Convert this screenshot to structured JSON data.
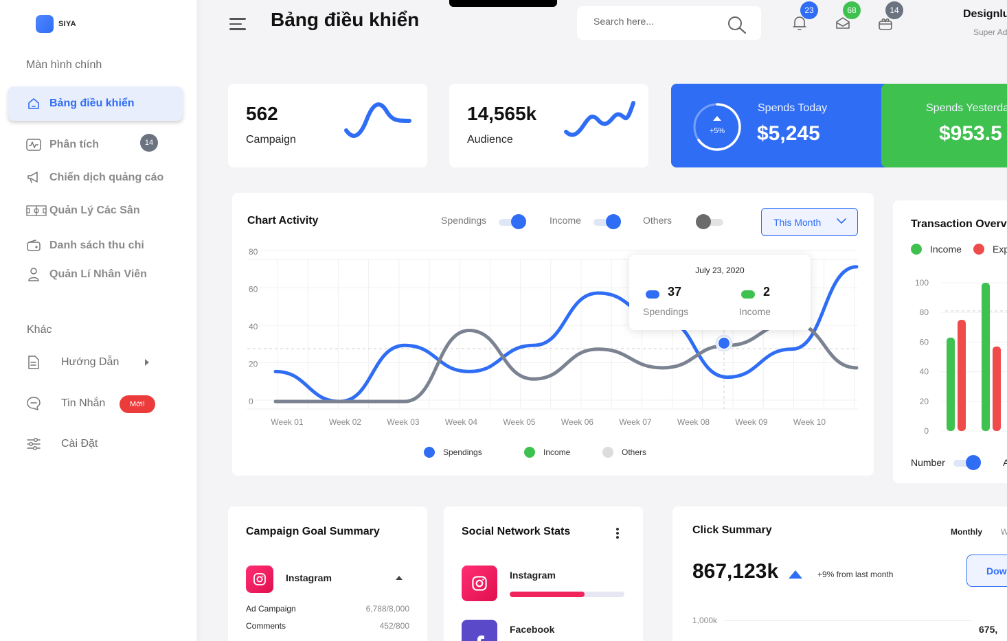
{
  "brand": {
    "name": "SIYA",
    "color": "#2f6df5"
  },
  "sidebar": {
    "main_section": "Màn hình chính",
    "items": [
      {
        "label": "Bảng điều khiển",
        "icon": "home-icon",
        "active": true
      },
      {
        "label": "Phân tích",
        "icon": "analytics-icon",
        "count": "14"
      },
      {
        "label": "Chiến dịch quảng cáo",
        "icon": "megaphone-icon"
      },
      {
        "label": "Quản Lý Các Sân",
        "icon": "field-icon"
      },
      {
        "label": "Danh sách thu chi",
        "icon": "wallet-icon"
      },
      {
        "label": "Quản Lí Nhân Viên",
        "icon": "user-icon"
      }
    ],
    "other_section": "Khác",
    "other_items": [
      {
        "label": "Hướng Dẫn",
        "icon": "document-icon"
      },
      {
        "label": "Tin Nhắn",
        "icon": "chat-icon",
        "badge": "Mới!"
      },
      {
        "label": "Cài Đặt",
        "icon": "settings-sliders-icon"
      }
    ]
  },
  "header": {
    "title": "Bảng điều khiển",
    "search_placeholder": "Search here...",
    "notifications": {
      "bell": "23",
      "mail": "68",
      "cart": "14"
    },
    "user_name": "Designlu",
    "user_role": "Super Ad"
  },
  "stats": {
    "campaign": {
      "value": "562",
      "label": "Campaign"
    },
    "audience": {
      "value": "14,565k",
      "label": "Audience"
    },
    "spends_today": {
      "label": "Spends Today",
      "value": "$5,245",
      "change": "+5%"
    },
    "spends_yesterday": {
      "label": "Spends Yesterda",
      "value": "$953.5"
    }
  },
  "chart_activity": {
    "title": "Chart Activity",
    "toggles": {
      "spendings": "Spendings",
      "income": "Income",
      "others": "Others"
    },
    "period_button": "This Month",
    "tooltip": {
      "date": "July 23, 2020",
      "spendings_value": "37",
      "spendings_label": "Spendings",
      "income_value": "2",
      "income_label": "Income"
    },
    "legend": {
      "spendings": "Spendings",
      "income": "Income",
      "others": "Others"
    }
  },
  "chart_data": [
    {
      "type": "line",
      "title": "Chart Activity",
      "categories": [
        "Week 01",
        "Week 02",
        "Week 03",
        "Week 04",
        "Week 05",
        "Week 06",
        "Week 07",
        "Week 08",
        "Week 09",
        "Week 10"
      ],
      "y_ticks": [
        "0",
        "20",
        "40",
        "60",
        "80"
      ],
      "ylim": [
        0,
        90
      ],
      "series": [
        {
          "name": "Spendings",
          "color": "#2f6df5",
          "values": [
            16,
            0,
            30,
            16,
            30,
            58,
            44,
            13,
            28,
            72
          ]
        },
        {
          "name": "Others",
          "color": "#7b8291",
          "values": [
            0,
            0,
            0,
            38,
            12,
            28,
            18,
            30,
            42,
            18
          ]
        }
      ],
      "grid": true
    },
    {
      "type": "bar",
      "title": "Transaction Overvi",
      "y_ticks": [
        "0",
        "20",
        "40",
        "60",
        "80",
        "100"
      ],
      "ylim": [
        0,
        100
      ],
      "series": [
        {
          "name": "Income",
          "color": "#3fc14f",
          "values": [
            63,
            100
          ]
        },
        {
          "name": "Exp",
          "color": "#ef4b4b",
          "values": [
            75,
            57
          ]
        }
      ],
      "toggle_label": "Number"
    }
  ],
  "transaction": {
    "title": "Transaction Overvi",
    "legend_income": "Income",
    "legend_exp": "Exp",
    "toggle_label": "Number",
    "extra_label": "A"
  },
  "campaign_goal": {
    "title": "Campaign Goal Summary",
    "platform": "Instagram",
    "rows": [
      {
        "label": "Ad Campaign",
        "value": "6,788/8,000"
      },
      {
        "label": "Comments",
        "value": "452/800"
      }
    ]
  },
  "social_stats": {
    "title": "Social Network Stats",
    "items": [
      {
        "name": "Instagram",
        "progress": 0.65
      },
      {
        "name": "Facebook"
      }
    ]
  },
  "click_summary": {
    "title": "Click Summary",
    "period_monthly": "Monthly",
    "period_weekly": "W",
    "value": "867,123k",
    "change": "+9% from last month",
    "download_label": "Dow",
    "y_tick": "1,000k",
    "side_value": "675,"
  }
}
